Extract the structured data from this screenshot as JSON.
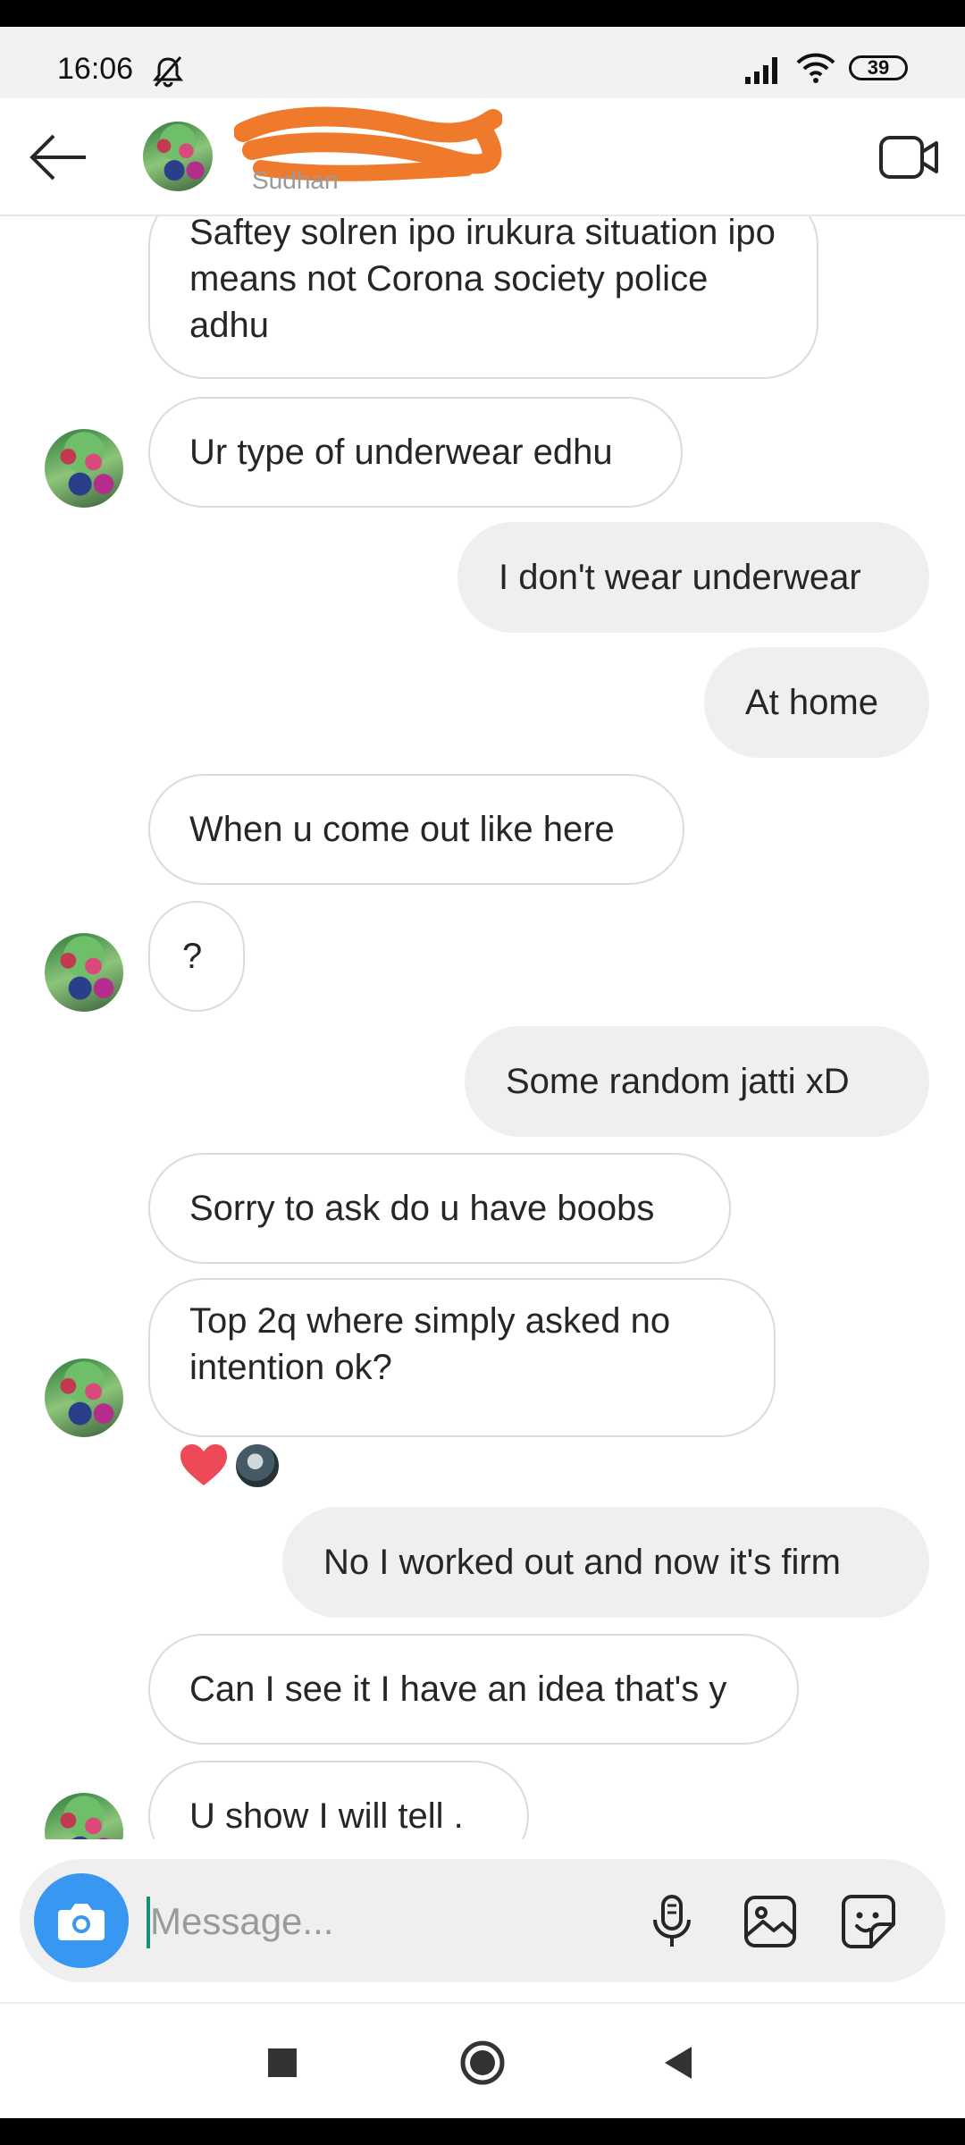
{
  "status_bar": {
    "time": "16:06",
    "battery": "39",
    "icons": [
      "mute-bell-icon",
      "signal-icon",
      "wifi-icon",
      "battery-icon"
    ]
  },
  "header": {
    "username_subtitle": "Sudhan",
    "back_icon": "arrow-left-icon",
    "video_icon": "video-camera-icon"
  },
  "messages": [
    {
      "side": "in",
      "text": "Saftey solren ipo irukura situation ipo means not Corona society police adhu",
      "avatar": false
    },
    {
      "side": "in",
      "text": "Ur type of underwear edhu",
      "avatar": true
    },
    {
      "side": "out",
      "text": "I don't wear underwear"
    },
    {
      "side": "out",
      "text": "At home"
    },
    {
      "side": "in",
      "text": "When u come out like here",
      "avatar": false
    },
    {
      "side": "in",
      "text": "?",
      "avatar": true
    },
    {
      "side": "out",
      "text": "Some random jatti  xD"
    },
    {
      "side": "in",
      "text": "Sorry to ask do u have boobs",
      "avatar": false
    },
    {
      "side": "in",
      "text": "Top  2q where simply asked no intention ok?",
      "avatar": true,
      "reactions": [
        "heart",
        "user-avatar"
      ]
    },
    {
      "side": "out",
      "text": "No I worked out and now it's firm"
    },
    {
      "side": "in",
      "text": "Can I see it I have an idea that's y",
      "avatar": false
    },
    {
      "side": "in",
      "text": "U show I will tell .",
      "avatar": true
    }
  ],
  "composer": {
    "placeholder": "Message...",
    "camera_icon": "camera-icon",
    "mic_icon": "microphone-icon",
    "gallery_icon": "image-icon",
    "sticker_icon": "sticker-icon"
  },
  "colors": {
    "camera_button": "#3897f0",
    "incoming_border": "#dbdbdb",
    "outgoing_bg": "#efefef",
    "heart": "#ed4956"
  },
  "nav": [
    "recents-square-icon",
    "home-circle-icon",
    "back-triangle-icon"
  ]
}
